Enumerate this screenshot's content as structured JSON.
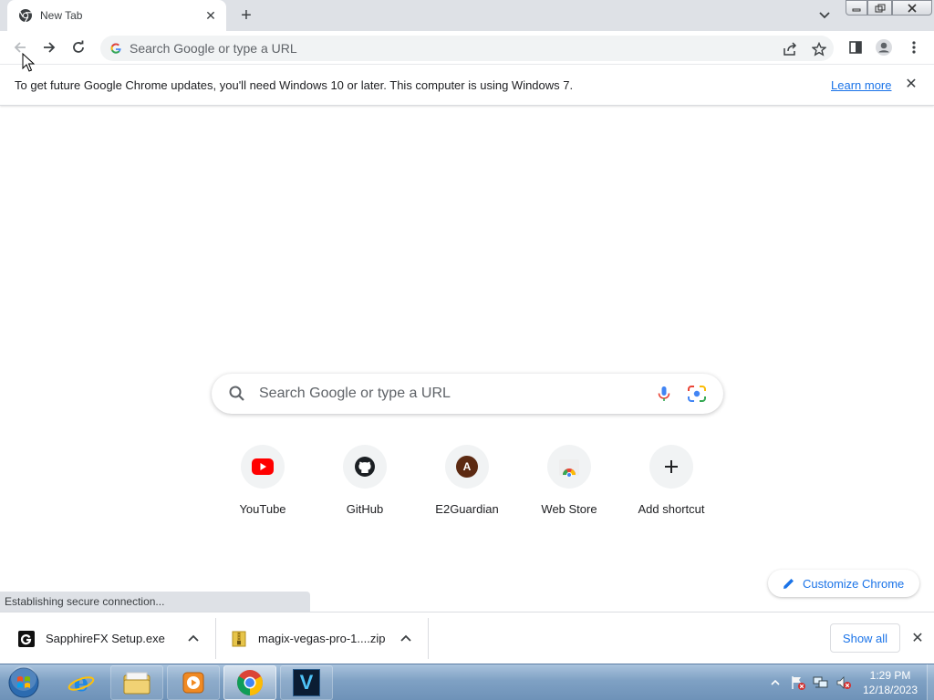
{
  "browser": {
    "tab": {
      "title": "New Tab"
    },
    "omnibox": {
      "placeholder": "Search Google or type a URL"
    }
  },
  "infobar": {
    "message": "To get future Google Chrome updates, you'll need Windows 10 or later. This computer is using Windows 7.",
    "link": "Learn more"
  },
  "ntp": {
    "search_placeholder": "Search Google or type a URL",
    "shortcuts": [
      {
        "label": "YouTube",
        "icon": "youtube-icon"
      },
      {
        "label": "GitHub",
        "icon": "github-icon"
      },
      {
        "label": "E2Guardian",
        "icon": "avatar-letter",
        "letter": "A"
      },
      {
        "label": "Web Store",
        "icon": "chrome-web-store-icon"
      },
      {
        "label": "Add shortcut",
        "icon": "plus-icon"
      }
    ],
    "customize_label": "Customize Chrome"
  },
  "status_text": "Establishing secure connection...",
  "downloads": {
    "items": [
      {
        "name": "SapphireFX Setup.exe",
        "icon": "installer-icon"
      },
      {
        "name": "magix-vegas-pro-1....zip",
        "icon": "zip-icon"
      }
    ],
    "show_all": "Show all"
  },
  "taskbar": {
    "apps": [
      "internet-explorer-icon",
      "file-explorer-icon",
      "media-player-icon",
      "chrome-icon",
      "vegas-icon"
    ],
    "vegas_letter": "V",
    "time": "1:29 PM",
    "date": "12/18/2023"
  },
  "colors": {
    "accent": "#1a73e8",
    "tabstrip": "#dee1e6",
    "youtube_red": "#ff0000",
    "avatar_brown": "#5c2a12"
  }
}
